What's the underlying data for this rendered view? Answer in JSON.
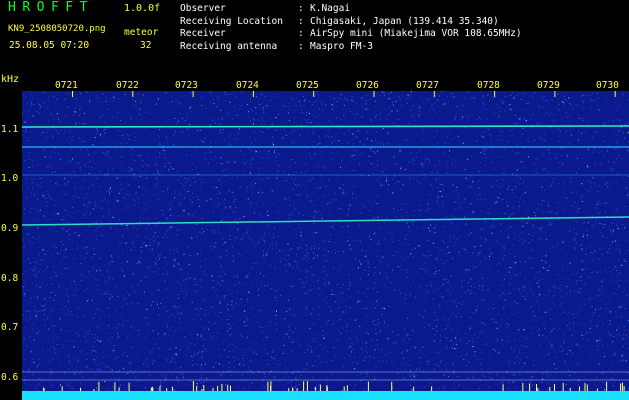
{
  "app": {
    "title": "HROFFT",
    "version": "1.0.0f",
    "filename": "KN9_2508050720.png",
    "mode": "meteor",
    "datetime": "25.08.05 07:20",
    "count": "32"
  },
  "info": [
    {
      "label": "Observer",
      "value": "K.Nagai"
    },
    {
      "label": "Receiving Location",
      "value": "Chigasaki, Japan (139.414 35.340)"
    },
    {
      "label": "Receiver",
      "value": "AirSpy mini (Miakejima VOR 108.65MHz)"
    },
    {
      "label": "Receiving antenna",
      "value": "Maspro FM-3"
    }
  ],
  "axis": {
    "unit": "kHz",
    "y_ticks": [
      "1.1",
      "1.0",
      "0.9",
      "0.8",
      "0.7",
      "0.6"
    ],
    "time_ticks": [
      "0721",
      "0722",
      "0723",
      "0724",
      "0725",
      "0726",
      "0727",
      "0728",
      "0729",
      "0730"
    ]
  },
  "colors": {
    "background": "#0a1a8c",
    "axis_text": "#ffff33",
    "title": "#00ff33",
    "info_text": "#ffffff",
    "bottom_band": "#19e0ff"
  }
}
